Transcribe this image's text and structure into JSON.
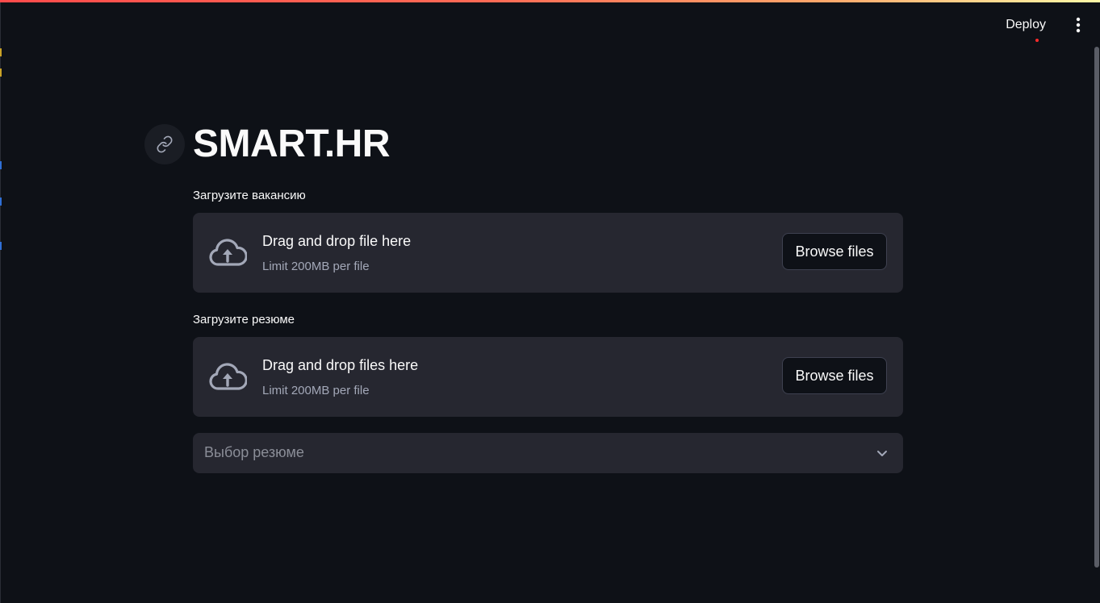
{
  "header": {
    "deploy_label": "Deploy",
    "menu_icon": "more-vertical-icon",
    "status_dot_color": "#ff2b2b",
    "accent_gradient": [
      "#ff4b4b",
      "#fff9a8"
    ]
  },
  "main": {
    "title": "SMART.HR",
    "anchor_icon": "link-icon",
    "vacancy_uploader": {
      "label": "Загрузите вакансию",
      "drop_text": "Drag and drop file here",
      "limit_text": "Limit 200MB per file",
      "button_label": "Browse files",
      "icon": "cloud-upload-icon"
    },
    "resume_uploader": {
      "label": "Загрузите резюме",
      "drop_text": "Drag and drop files here",
      "limit_text": "Limit 200MB per file",
      "button_label": "Browse files",
      "icon": "cloud-upload-icon"
    },
    "resume_select": {
      "placeholder": "Выбор резюме",
      "icon": "chevron-down-icon"
    }
  },
  "theme": {
    "background": "#0e1117",
    "surface": "#262730",
    "text": "#fafafa",
    "muted_text": "#a3a8b8"
  }
}
